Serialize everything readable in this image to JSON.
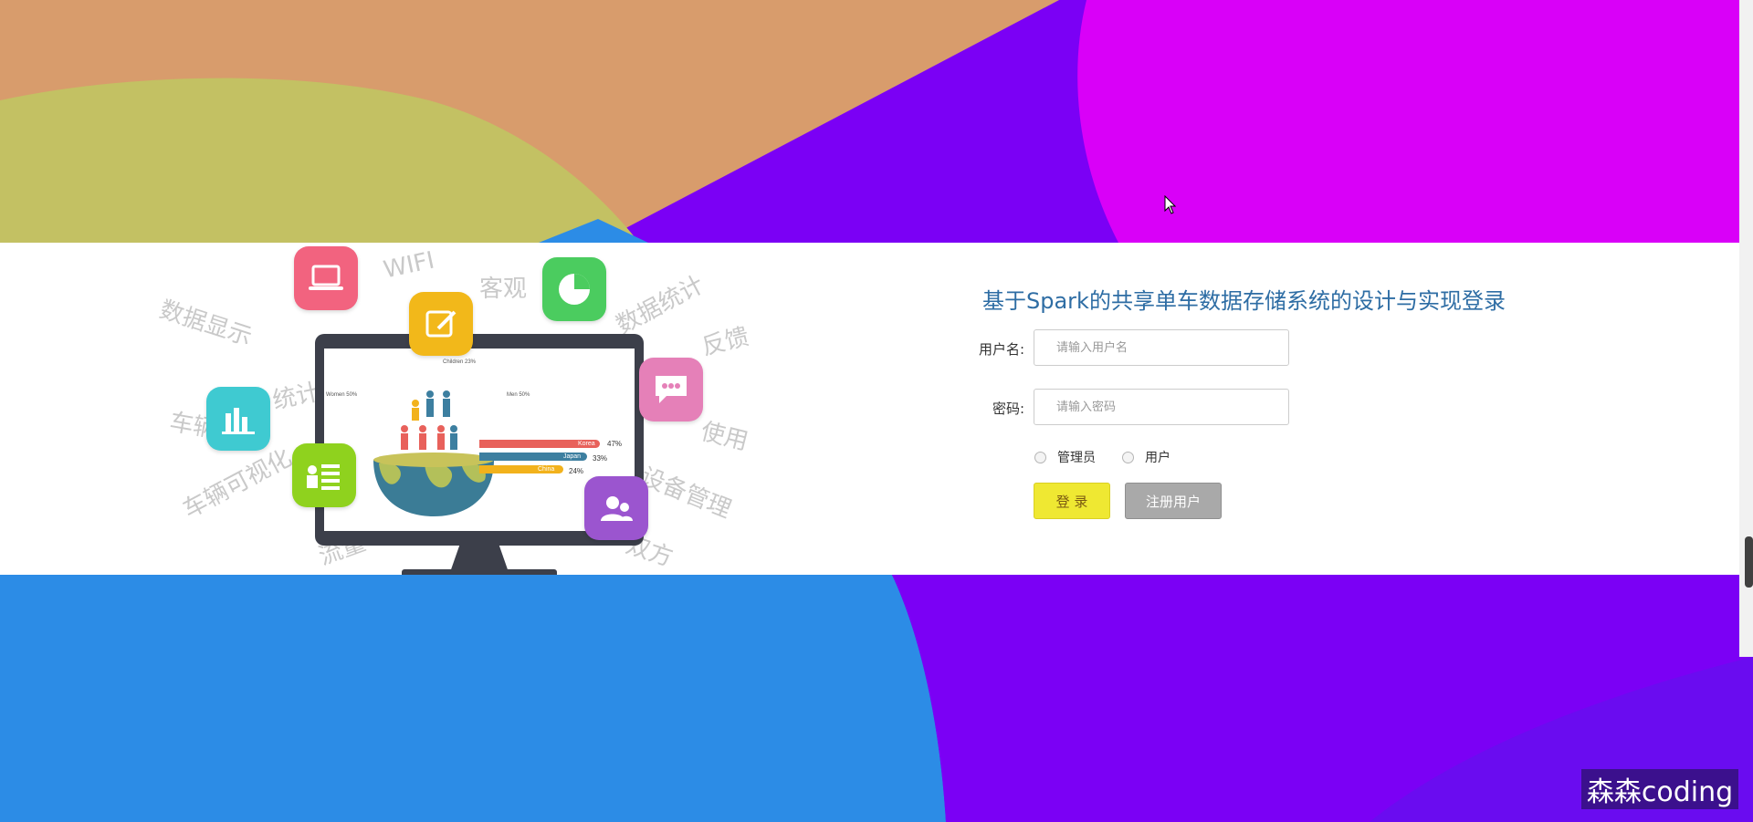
{
  "colors": {
    "band": "#ffffff",
    "title": "#2e6da4",
    "login_button": "#efe832",
    "register_button": "#a9a9a9",
    "bg_orange": "#d89c6c",
    "bg_olive": "#c3c163",
    "bg_purple": "#7b00f5",
    "bg_magenta": "#d900f8",
    "bg_blue": "#2c8ce6"
  },
  "illustration": {
    "words": [
      "WIFI",
      "客观",
      "数据显示",
      "数据统计",
      "反馈",
      "统计",
      "车辆",
      "使用",
      "车辆可视化",
      "设备管理",
      "流量",
      "双方"
    ],
    "icons": [
      "laptop-icon",
      "edit-icon",
      "pie-chart-icon",
      "chat-icon",
      "bar-chart-icon",
      "list-icon",
      "users-icon"
    ],
    "screen": {
      "labels": [
        "Children 23%",
        "Women 50%",
        "Men 50%"
      ],
      "bars": [
        {
          "label": "Korea",
          "pct": "47%",
          "color": "#e8615b"
        },
        {
          "label": "Japan",
          "pct": "33%",
          "color": "#3d7fa0"
        },
        {
          "label": "China",
          "pct": "24%",
          "color": "#f2b21c"
        }
      ]
    }
  },
  "login": {
    "title": "基于Spark的共享单车数据存储系统的设计与实现登录",
    "username_label": "用户名:",
    "username_placeholder": "请输入用户名",
    "password_label": "密码:",
    "password_placeholder": "请输入密码",
    "roles": [
      "管理员",
      "用户"
    ],
    "login_button": "登 录",
    "register_button": "注册用户"
  },
  "watermark": "森森coding"
}
